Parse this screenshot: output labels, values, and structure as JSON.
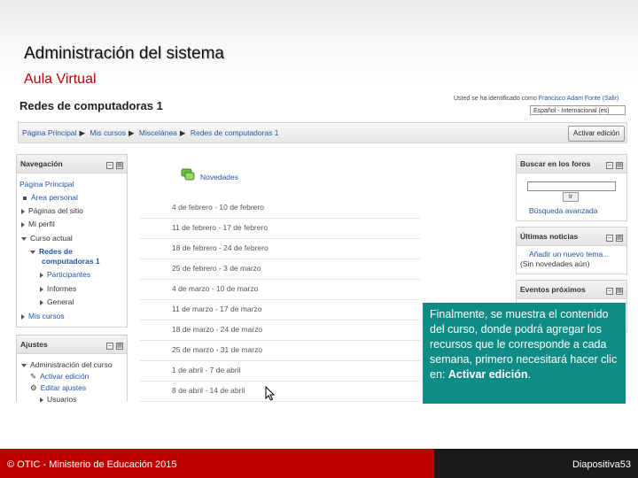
{
  "slide": {
    "title": "Administración del sistema",
    "subtitle": "Aula Virtual"
  },
  "moodle": {
    "course_title": "Redes de computadoras 1",
    "login_prefix": "Usted se ha identificado como",
    "login_user": "Francisco Adam Fonte",
    "login_logout": "(Salir)",
    "language": "Español - Internacional (es)",
    "breadcrumb": [
      "Página Principal",
      "Mis cursos",
      "Miscelánea",
      "Redes de computadoras 1"
    ],
    "edit_button": "Activar edición",
    "navigation": {
      "title": "Navegación",
      "items": {
        "home": "Página Principal",
        "personal": "Área personal",
        "site_pages": "Páginas del sitio",
        "profile": "Mi perfil",
        "current_course": "Curso actual",
        "course_l1": "Redes de",
        "course_l2": "computadoras 1",
        "participants": "Participantes",
        "reports": "Informes",
        "general": "General",
        "my_courses": "Mis cursos"
      }
    },
    "settings": {
      "title": "Ajustes",
      "admin_course": "Administración del curso",
      "enable_editing": "Activar edición",
      "edit_settings": "Editar ajustes",
      "users": "Usuarios"
    },
    "news_forum": "Novedades",
    "weeks": [
      "4 de febrero - 10 de febrero",
      "11 de febrero - 17 de febrero",
      "18 de febrero - 24 de febrero",
      "25 de febrero - 3 de marzo",
      "4 de marzo - 10 de marzo",
      "11 de marzo - 17 de marzo",
      "18 de marzo - 24 de marzo",
      "25 de marzo - 31 de marzo",
      "1 de abril - 7 de abril",
      "8 de abril - 14 de abril"
    ],
    "search_forums": {
      "title": "Buscar en los foros",
      "button": "Ir",
      "advanced": "Búsqueda avanzada"
    },
    "latest_news": {
      "title": "Últimas noticias",
      "add_topic": "Añadir un nuevo tema...",
      "no_news": "(Sin novedades aún)"
    },
    "upcoming_events": {
      "title": "Eventos próximos"
    }
  },
  "callout": {
    "text": "Finalmente, se muestra el contenido del curso, donde podrá agregar los recursos que le corresponde a cada semana, primero necesitará hacer clic en:",
    "emphasis": "Activar edición",
    "end": "."
  },
  "footer": {
    "copyright": "© OTIC - Ministerio de Educación 2015",
    "page_label": "Diapositiva",
    "page_number": "53"
  },
  "colors": {
    "accent_red": "#c00000",
    "callout_teal": "#0e8c85",
    "link_blue": "#2255aa",
    "footer_dark": "#1b1b1b"
  }
}
